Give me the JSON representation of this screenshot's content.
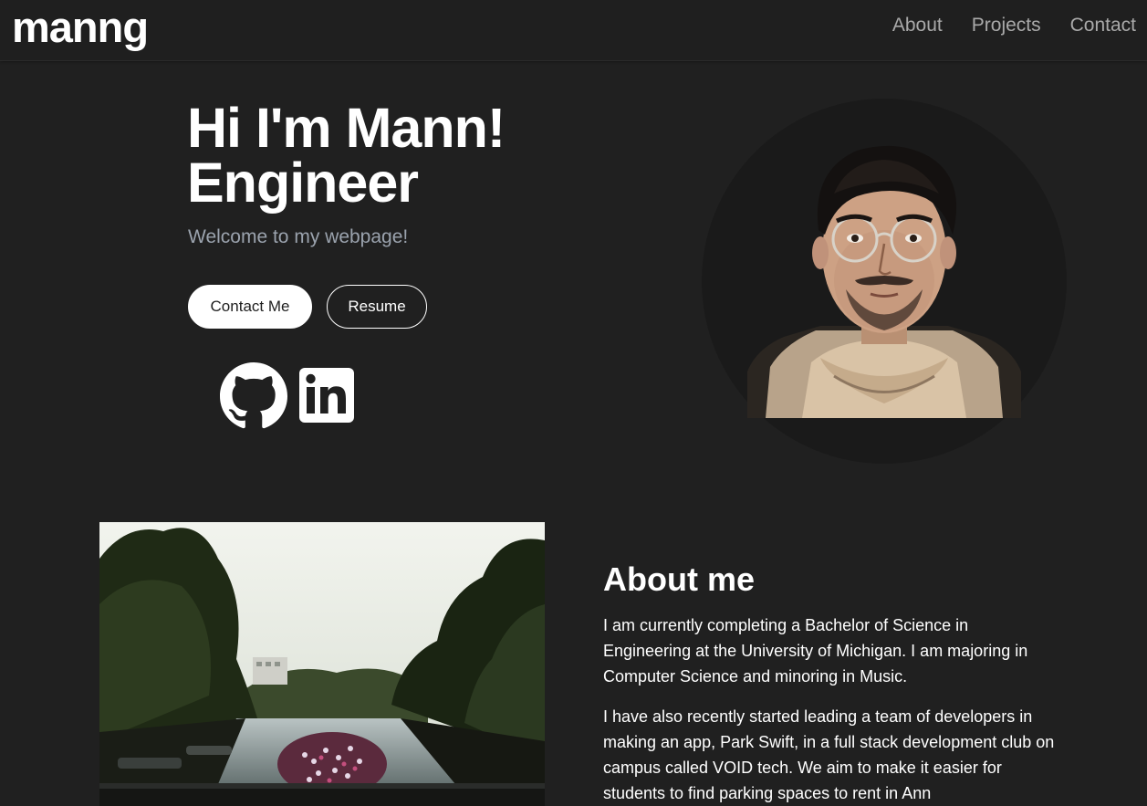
{
  "nav": {
    "brand": "manng",
    "links": [
      "About",
      "Projects",
      "Contact"
    ]
  },
  "hero": {
    "line1": "Hi I'm Mann!",
    "line2": "Engineer",
    "subtitle": "Welcome to my webpage!",
    "contact_button": "Contact Me",
    "resume_button": "Resume"
  },
  "social": {
    "github_icon": "github-icon",
    "linkedin_icon": "linkedin-icon"
  },
  "about": {
    "title": "About me",
    "paragraph1": "I am currently completing a Bachelor of Science in Engineering at the University of Michigan. I am majoring in Computer Science and minoring in Music.",
    "paragraph2": "I have also recently started leading a team of developers in making an app, Park Swift, in a full stack development club on campus called VOID tech. We aim to make it easier for students to find parking spaces to rent in Ann"
  },
  "colors": {
    "background": "#202020",
    "navbar": "#1f1f1f",
    "muted_text": "#a9a9a9",
    "subtitle_text": "#9ba3ae",
    "avatar_circle": "#1a1a1a"
  }
}
